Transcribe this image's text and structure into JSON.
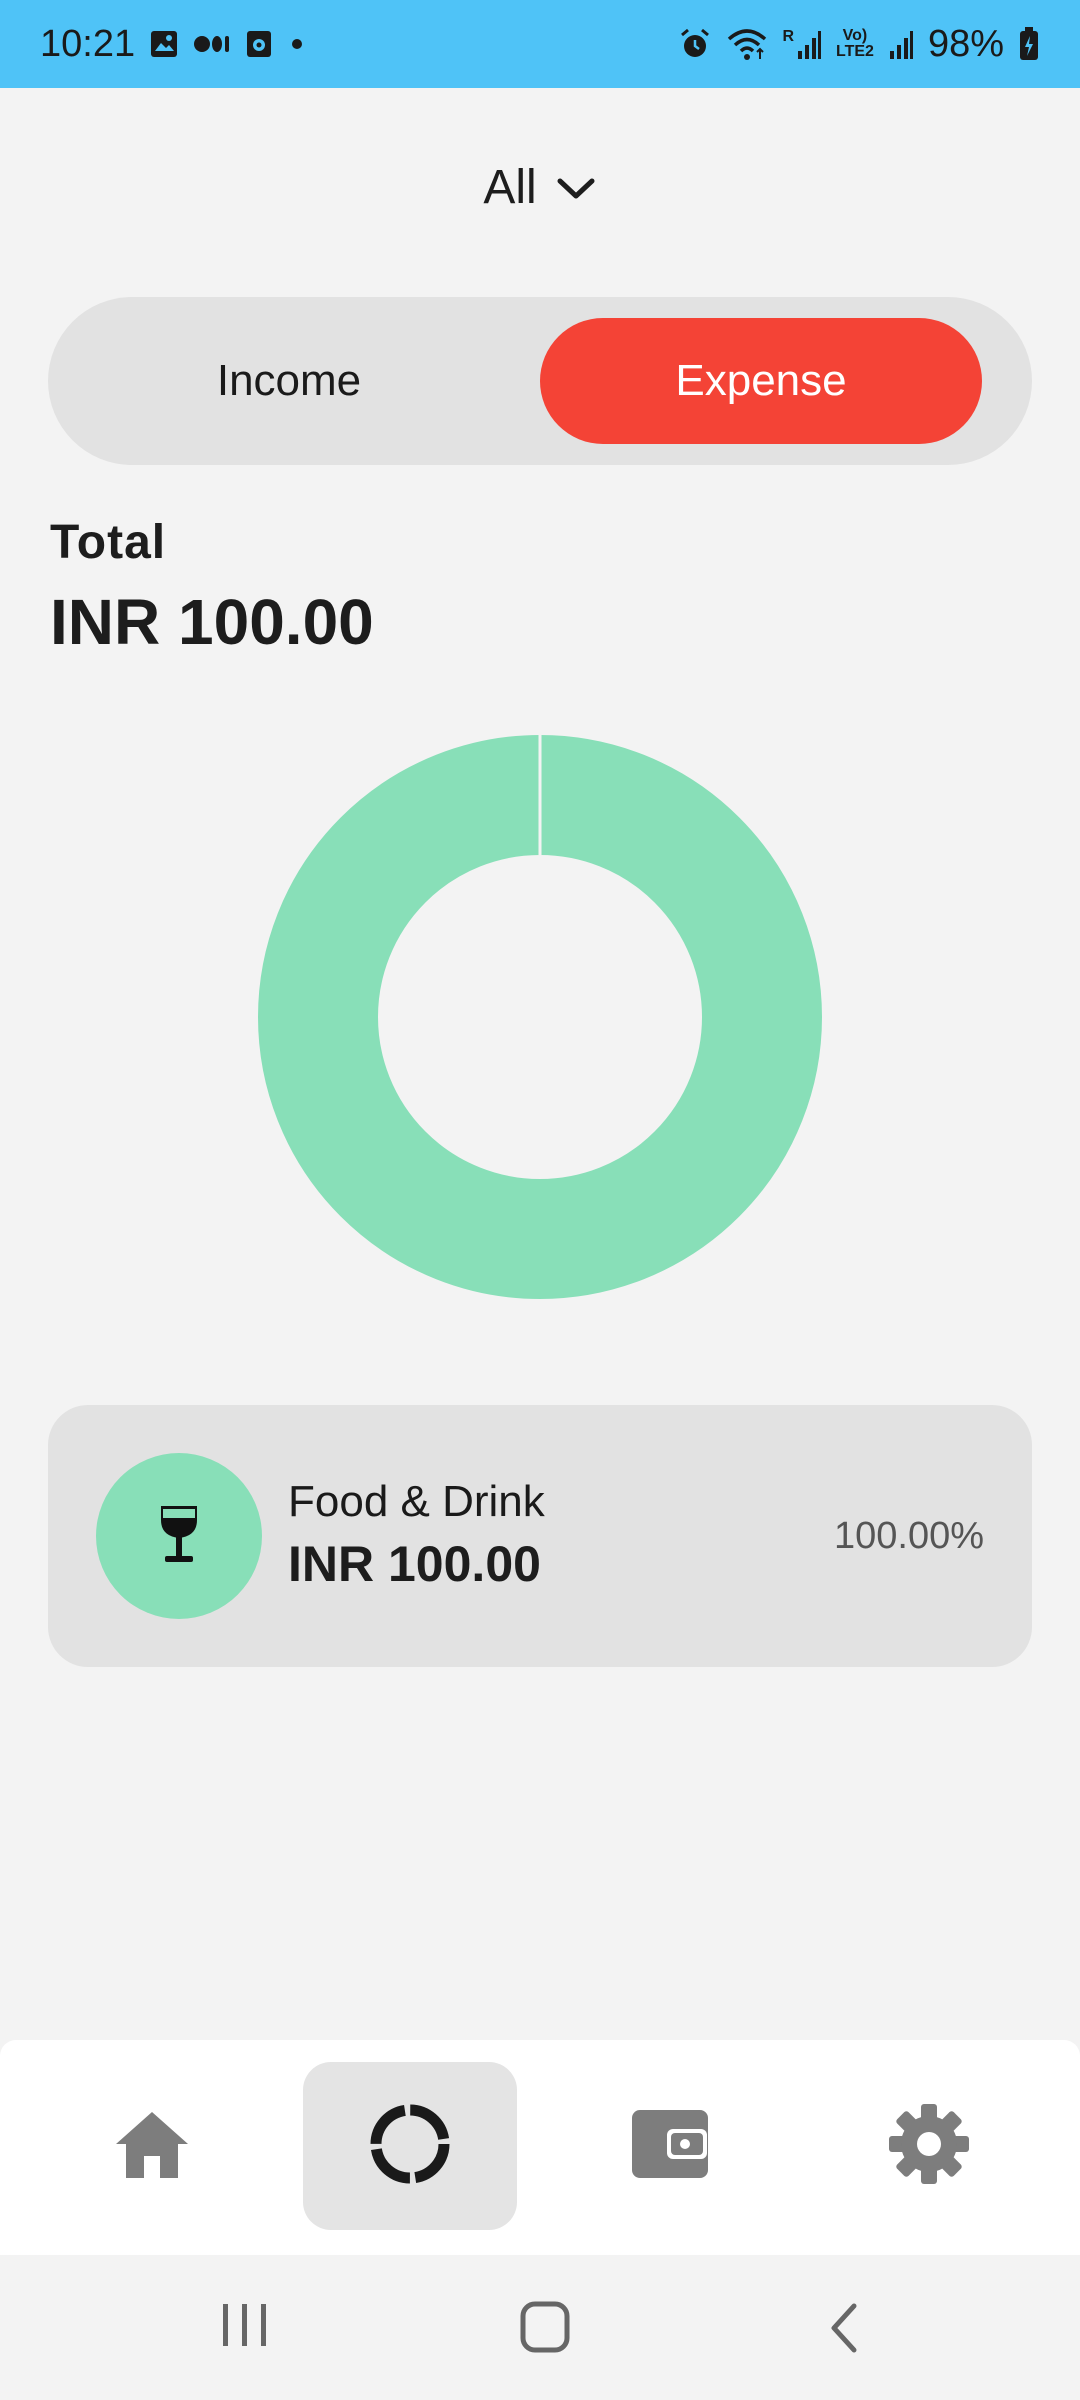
{
  "status_bar": {
    "time": "10:21",
    "battery": "98%",
    "signal_label_top": "Vo)",
    "signal_label_bottom": "LTE2",
    "sim_label": "R"
  },
  "filter": {
    "label": "All"
  },
  "segment": {
    "income_label": "Income",
    "expense_label": "Expense",
    "selected": "Expense"
  },
  "summary": {
    "total_label": "Total",
    "total_value": "INR 100.00"
  },
  "chart_data": {
    "type": "pie",
    "categories": [
      "Food & Drink"
    ],
    "values": [
      100.0
    ],
    "colors": [
      "#88dfb8"
    ]
  },
  "categories": [
    {
      "name": "Food & Drink",
      "amount": "INR 100.00",
      "percent": "100.00%",
      "icon": "wine-glass-icon",
      "color": "#88dfb8"
    }
  ],
  "bottom_nav": {
    "items": [
      {
        "name": "home",
        "icon": "home-icon"
      },
      {
        "name": "stats",
        "icon": "donut-chart-icon",
        "active": true
      },
      {
        "name": "wallet",
        "icon": "wallet-icon"
      },
      {
        "name": "settings",
        "icon": "gear-icon"
      }
    ]
  },
  "colors": {
    "status_bar": "#4fc3f7",
    "expense": "#f44336",
    "accent_green": "#88dfb8"
  }
}
